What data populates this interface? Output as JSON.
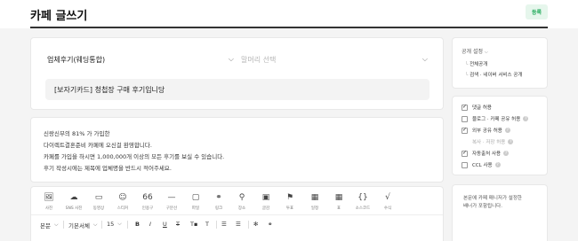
{
  "header": {
    "title": "카페 글쓰기",
    "submit_label": "등록"
  },
  "compose": {
    "board_select": "업체후기(웨딩통합)",
    "head_placeholder": "말머리 선택",
    "title_value": "[보자기카드] 청첩장 구매 후기입니당"
  },
  "notice": {
    "lines": [
      "신랑신부의 81% 가 가입한",
      "다이렉트결혼준비 카페에 오신걸 환영합니다.",
      "카페를 가입을 하시면 1,000,000개 이상의 모든 후기를 보실 수 있습니다.",
      "후기 작성시에는 제목에 업체명을 반드시 적어주세요."
    ]
  },
  "toolbar": {
    "tools": [
      {
        "label": "사진",
        "icon": "🖼"
      },
      {
        "label": "SNS 사진",
        "icon": "☁"
      },
      {
        "label": "동영상",
        "icon": "▭"
      },
      {
        "label": "스티커",
        "icon": "☺"
      },
      {
        "label": "인용구",
        "icon": "66"
      },
      {
        "label": "구분선",
        "icon": "—"
      },
      {
        "label": "파일",
        "icon": "▢"
      },
      {
        "label": "링크",
        "icon": "⚭"
      },
      {
        "label": "장소",
        "icon": "⚲"
      },
      {
        "label": "글감",
        "icon": "▣"
      },
      {
        "label": "투표",
        "icon": "⚑"
      },
      {
        "label": "일정",
        "icon": "▦"
      },
      {
        "label": "표",
        "icon": "▦"
      },
      {
        "label": "소스코드",
        "icon": "{}"
      },
      {
        "label": "수식",
        "icon": "√"
      }
    ],
    "format": {
      "style": "본문",
      "font": "기본서체",
      "size": "15"
    }
  },
  "sidebar": {
    "open_settings": {
      "title": "공개 설정",
      "items": [
        "전체공개",
        "검색 · 네이버 서비스 공개"
      ]
    },
    "options": [
      {
        "label": "댓글 허용",
        "checked": true,
        "disabled": false,
        "help": false
      },
      {
        "label": "블로그 · 카페 공유 허용",
        "checked": false,
        "disabled": false,
        "help": true
      },
      {
        "label": "외부 공유 허용",
        "checked": true,
        "disabled": false,
        "help": true
      },
      {
        "label": "복사 · 저장 허용",
        "checked": false,
        "disabled": true,
        "help": true
      },
      {
        "label": "자동출처 사용",
        "checked": true,
        "disabled": false,
        "help": true
      },
      {
        "label": "CCL 사용",
        "checked": false,
        "disabled": false,
        "help": true
      }
    ],
    "info_lines": [
      "본문에 카페 매니저가 설정한",
      "배너가 포함됩니다."
    ]
  },
  "colors": {
    "accent": "#1ba856",
    "accent_bg": "#e6f6ec"
  }
}
